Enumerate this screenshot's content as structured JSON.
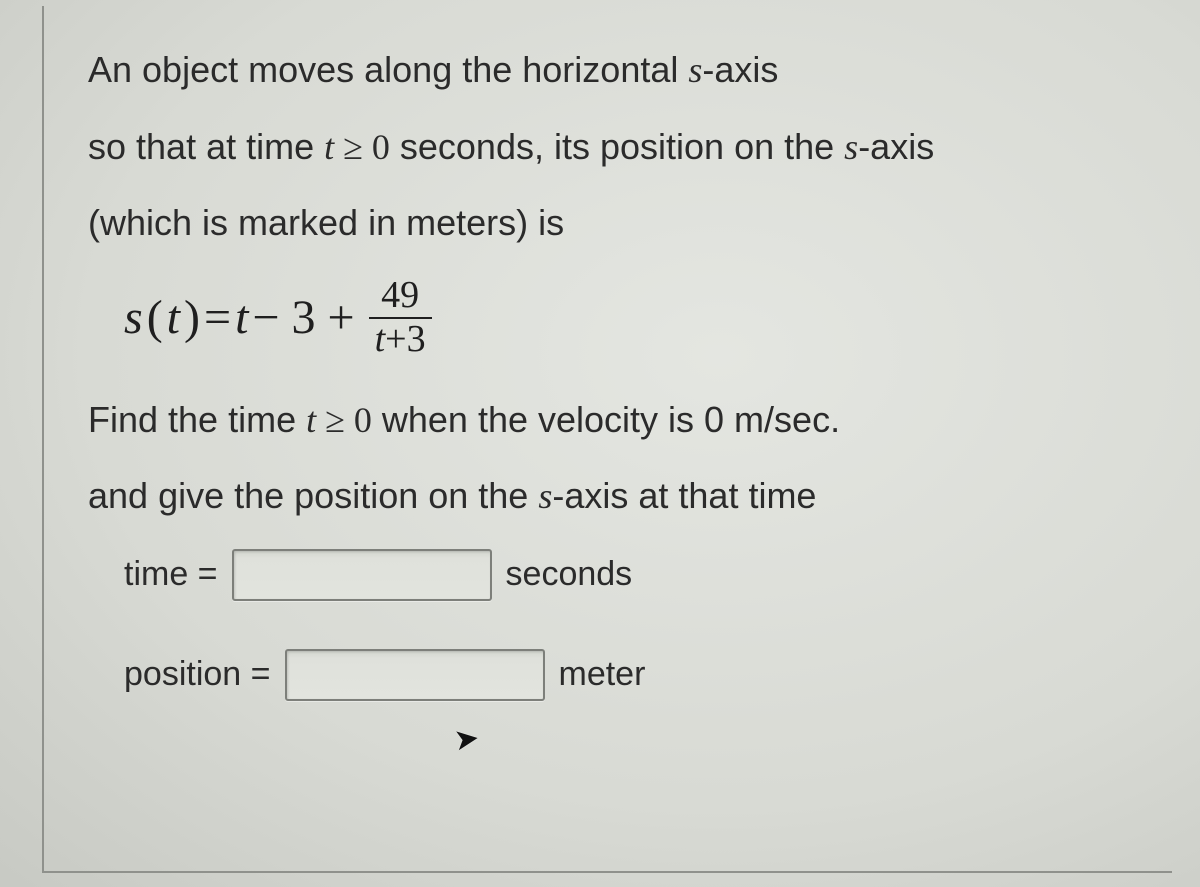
{
  "problem": {
    "line1_a": "An object moves along the horizontal ",
    "line1_var": "s",
    "line1_b": "-axis",
    "line2_a": "so that at time ",
    "line2_var": "t",
    "line2_ge": " ≥ ",
    "line2_zero": "0",
    "line2_b": " seconds, its position on the ",
    "line2_var2": "s",
    "line2_c": "-axis",
    "line3": "(which is marked in meters) is",
    "formula": {
      "s": "s",
      "open": " (",
      "t": "t",
      "close": ") ",
      "eq": "= ",
      "t2": "t",
      "minus": " − 3 + ",
      "num": "49",
      "den_t": "t",
      "den_plus": "+",
      "den_3": "3"
    },
    "line4_a": "Find the time  ",
    "line4_var": "t",
    "line4_ge": " ≥ ",
    "line4_zero": "0",
    "line4_b": " when the velocity is 0 m/sec.",
    "line5_a": "and give the position on the ",
    "line5_var": "s",
    "line5_b": "-axis at that time"
  },
  "answers": {
    "time_label": "time =",
    "time_value": "",
    "time_unit": "seconds",
    "position_label": "position =",
    "position_value": "",
    "position_unit": "meter"
  }
}
